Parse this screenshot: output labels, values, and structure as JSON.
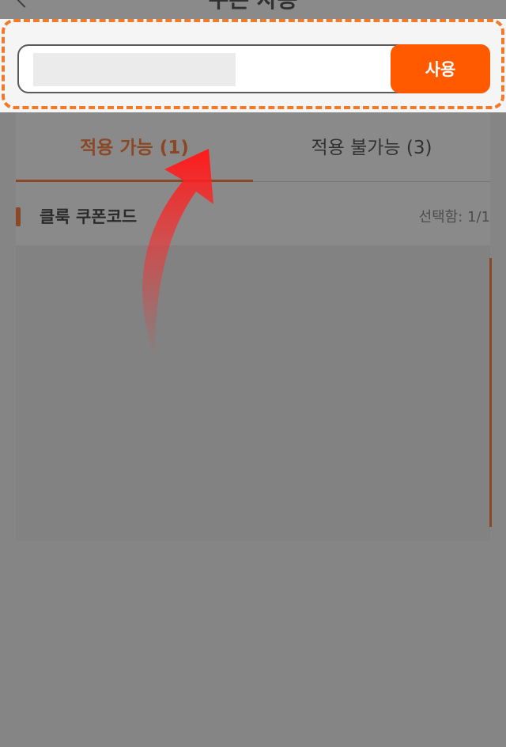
{
  "nav": {
    "title": "쿠폰 사용"
  },
  "coupon_input": {
    "value": "",
    "placeholder": "",
    "use_label": "사용"
  },
  "tabs": [
    {
      "label": "적용 가능 (1)",
      "active": true
    },
    {
      "label": "적용 불가능 (3)",
      "active": false
    }
  ],
  "section": {
    "title": "클룩 쿠폰코드",
    "selection_count": "선택함: 1/1"
  },
  "colors": {
    "accent": "#ff5a00",
    "highlight_border": "#f07a2a",
    "arrow": "#ff2a2a"
  },
  "icons": {
    "back": "chevron-left-icon",
    "hint": "curved-arrow-up-icon"
  }
}
